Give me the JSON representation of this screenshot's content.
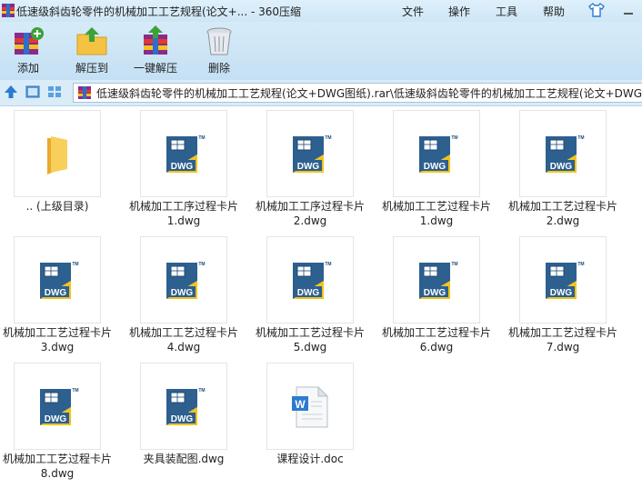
{
  "window": {
    "title": "低速级斜齿轮零件的机械加工工艺规程(论文+... - 360压缩",
    "menu": [
      "文件",
      "操作",
      "工具",
      "帮助"
    ]
  },
  "toolbar": [
    {
      "label": "添加",
      "icon": "add-archive-icon"
    },
    {
      "label": "解压到",
      "icon": "extract-to-icon"
    },
    {
      "label": "一键解压",
      "icon": "one-click-extract-icon"
    },
    {
      "label": "删除",
      "icon": "delete-trash-icon"
    }
  ],
  "address": {
    "path": "低速级斜齿轮零件的机械加工工艺规程(论文+DWG图纸).rar\\低速级斜齿轮零件的机械加工工艺规程(论文+DWG图"
  },
  "files": [
    {
      "line1": ".. (上级目录)",
      "line2": "",
      "type": "folder"
    },
    {
      "line1": "机械加工工序过程卡片",
      "line2": "1.dwg",
      "type": "dwg"
    },
    {
      "line1": "机械加工工序过程卡片",
      "line2": "2.dwg",
      "type": "dwg"
    },
    {
      "line1": "机械加工工艺过程卡片",
      "line2": "1.dwg",
      "type": "dwg"
    },
    {
      "line1": "机械加工工艺过程卡片",
      "line2": "2.dwg",
      "type": "dwg"
    },
    {
      "line1": "机械加工工艺过程卡片",
      "line2": "3.dwg",
      "type": "dwg"
    },
    {
      "line1": "机械加工工艺过程卡片",
      "line2": "4.dwg",
      "type": "dwg"
    },
    {
      "line1": "机械加工工艺过程卡片",
      "line2": "5.dwg",
      "type": "dwg"
    },
    {
      "line1": "机械加工工艺过程卡片",
      "line2": "6.dwg",
      "type": "dwg"
    },
    {
      "line1": "机械加工工艺过程卡片",
      "line2": "7.dwg",
      "type": "dwg"
    },
    {
      "line1": "机械加工工艺过程卡片",
      "line2": "8.dwg",
      "type": "dwg"
    },
    {
      "line1": "夹具装配图.dwg",
      "line2": "",
      "type": "dwg"
    },
    {
      "line1": "课程设计.doc",
      "line2": "",
      "type": "doc"
    }
  ],
  "icon_labels": {
    "dwg_badge": "DWG",
    "tm": "TM",
    "word_badge": "W"
  },
  "colors": {
    "accent": "#2b7bd0",
    "dwg_yellow": "#f2c41a",
    "dwg_blue": "#2d5f8f",
    "folder": "#f5c342"
  }
}
